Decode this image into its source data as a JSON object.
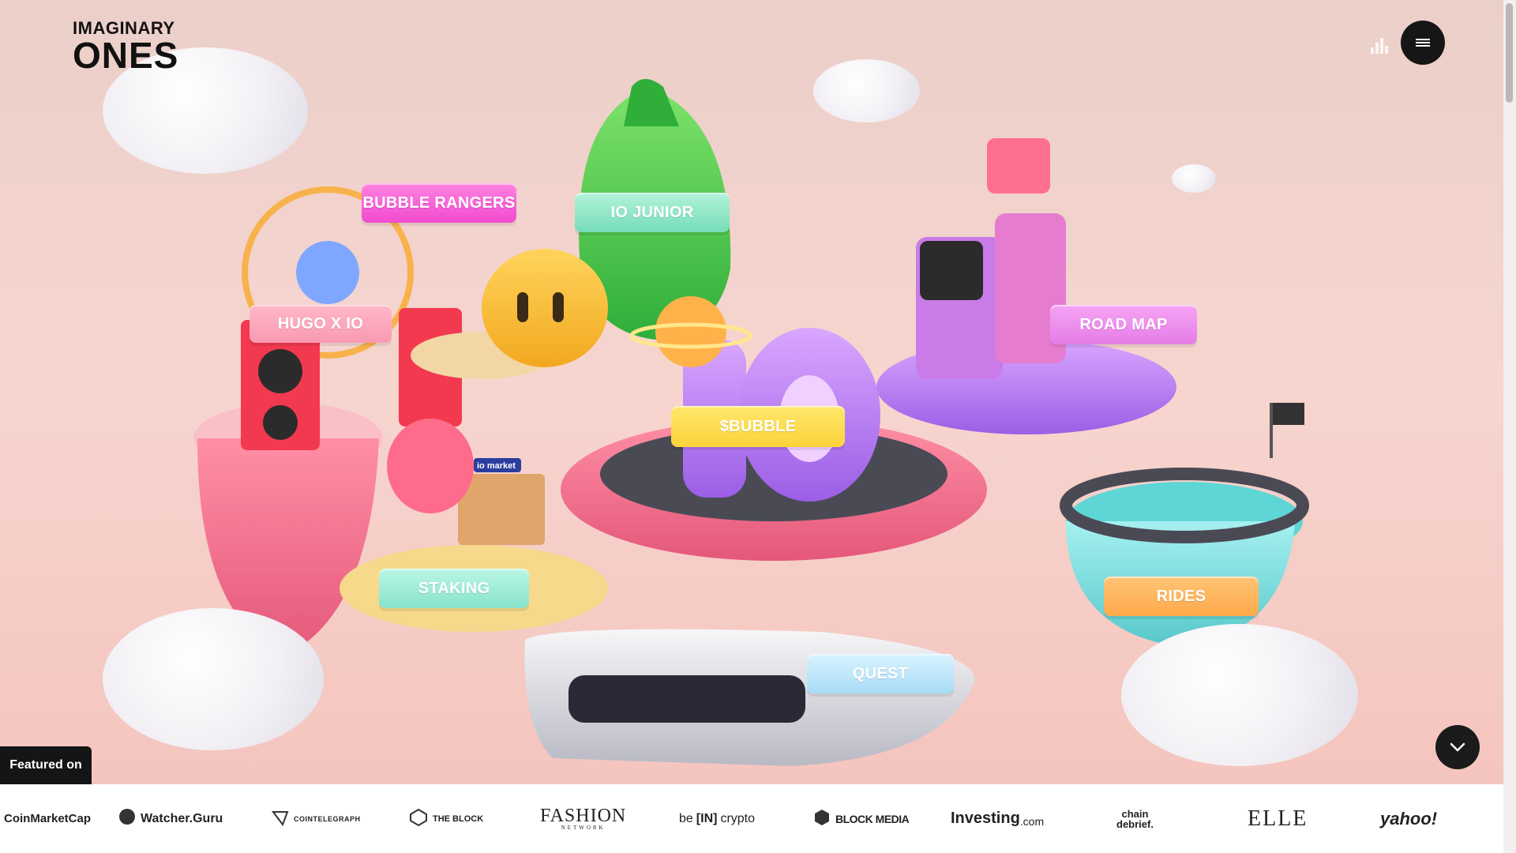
{
  "brand": {
    "line1": "IMAGINARY",
    "line2": "ONES"
  },
  "header": {
    "sound_icon": "sound-bars-icon",
    "menu_icon": "hamburger-menu-icon"
  },
  "scene": {
    "tags": {
      "bubble_rangers": "BUBBLE RANGERS",
      "io_junior": "IO JUNIOR",
      "hugo_x_io": "HUGO X IO",
      "road_map": "ROAD MAP",
      "bubble_token": "$BUBBLE",
      "staking": "STAKING",
      "rides": "RIDES",
      "quest": "QUEST"
    },
    "market_sign": "io market"
  },
  "scroll_down_icon": "chevron-down-icon",
  "featured": {
    "label": "Featured on",
    "press": [
      "CoinMarketCap",
      "Watcher.Guru",
      "COINTELEGRAPH",
      "THE BLOCK",
      "FASHION",
      "NETWORK",
      "be",
      "[IN]",
      "crypto",
      "BLOCK MEDIA",
      "Investing",
      ".com",
      "chain",
      "debrief.",
      "ELLE",
      "yahoo!"
    ]
  },
  "colors": {
    "accent_dark": "#151515",
    "bg_pink": "#f7d5cf",
    "tag_pink": "#f04bd0",
    "tag_mint": "#75dcb8",
    "tag_yellow": "#fcd33a",
    "tag_orange": "#ffa94a",
    "tag_lilac": "#e57ce7",
    "tag_sky": "#a8dcf6"
  }
}
